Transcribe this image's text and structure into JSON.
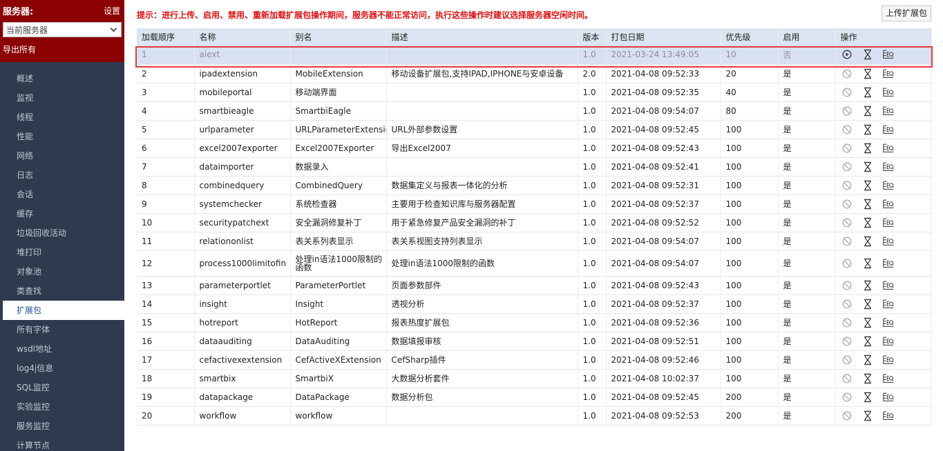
{
  "sidebar": {
    "title": "服务器:",
    "settings": "设置",
    "server_select": "当前服务器",
    "export_all": "导出所有",
    "items": [
      "概述",
      "监视",
      "线程",
      "性能",
      "网络",
      "日志",
      "会话",
      "缓存",
      "垃圾回收活动",
      "堆打印",
      "对象池",
      "类查找",
      "扩展包",
      "所有字体",
      "wsdl地址",
      "log4j信息",
      "SQL监控",
      "实验监控",
      "服务监控",
      "计算节点"
    ],
    "active_index": 12
  },
  "main": {
    "notice": "提示：进行上传、启用、禁用、重新加载扩展包操作期间，服务器不能正常访问，执行这些操作时建议选择服务器空闲时间。",
    "upload_button": "上传扩展包",
    "columns": [
      "加载顺序",
      "名称",
      "别名",
      "描述",
      "版本",
      "打包日期",
      "优先级",
      "启用",
      "操作"
    ],
    "rows": [
      {
        "order": "1",
        "name": "aiext",
        "alias": "",
        "desc": "",
        "version": "1.0",
        "date": "2021-03-24 13:49:05",
        "priority": "10",
        "enabled": "否"
      },
      {
        "order": "2",
        "name": "ipadextension",
        "alias": "MobileExtension",
        "desc": "移动设备扩展包,支持IPAD,IPHONE与安卓设备",
        "version": "2.0",
        "date": "2021-04-08 09:52:33",
        "priority": "20",
        "enabled": "是"
      },
      {
        "order": "3",
        "name": "mobileportal",
        "alias": "移动端界面",
        "desc": "",
        "version": "1.0",
        "date": "2021-04-08 09:52:35",
        "priority": "40",
        "enabled": "是"
      },
      {
        "order": "4",
        "name": "smartbieagle",
        "alias": "SmartbiEagle",
        "desc": "",
        "version": "1.0",
        "date": "2021-04-08 09:54:07",
        "priority": "80",
        "enabled": "是"
      },
      {
        "order": "5",
        "name": "urlparameter",
        "alias": "URLParameterExtension",
        "desc": "URL外部参数设置",
        "version": "1.0",
        "date": "2021-04-08 09:52:45",
        "priority": "100",
        "enabled": "是"
      },
      {
        "order": "6",
        "name": "excel2007exporter",
        "alias": "Excel2007Exporter",
        "desc": "导出Excel2007",
        "version": "1.0",
        "date": "2021-04-08 09:52:43",
        "priority": "100",
        "enabled": "是"
      },
      {
        "order": "7",
        "name": "dataimporter",
        "alias": "数据录入",
        "desc": "",
        "version": "1.0",
        "date": "2021-04-08 09:52:41",
        "priority": "100",
        "enabled": "是"
      },
      {
        "order": "8",
        "name": "combinedquery",
        "alias": "CombinedQuery",
        "desc": "数据集定义与报表一体化的分析",
        "version": "1.0",
        "date": "2021-04-08 09:52:31",
        "priority": "100",
        "enabled": "是"
      },
      {
        "order": "9",
        "name": "systemchecker",
        "alias": "系统检查器",
        "desc": "主要用于检查知识库与服务器配置",
        "version": "1.0",
        "date": "2021-04-08 09:52:37",
        "priority": "100",
        "enabled": "是"
      },
      {
        "order": "10",
        "name": "securitypatchext",
        "alias": "安全漏洞修复补丁",
        "desc": "用于紧急修复产品安全漏洞的补丁",
        "version": "1.0",
        "date": "2021-04-08 09:52:52",
        "priority": "100",
        "enabled": "是"
      },
      {
        "order": "11",
        "name": "relationonlist",
        "alias": "表关系列表显示",
        "desc": "表关系视图支持列表显示",
        "version": "1.0",
        "date": "2021-04-08 09:54:07",
        "priority": "100",
        "enabled": "是"
      },
      {
        "order": "12",
        "name": "process1000limitofin",
        "alias": "处理in语法1000限制的函数",
        "desc": "处理in语法1000限制的函数",
        "version": "1.0",
        "date": "2021-04-08 09:54:07",
        "priority": "100",
        "enabled": "是"
      },
      {
        "order": "13",
        "name": "parameterportlet",
        "alias": "ParameterPortlet",
        "desc": "页面参数部件",
        "version": "1.0",
        "date": "2021-04-08 09:52:43",
        "priority": "100",
        "enabled": "是"
      },
      {
        "order": "14",
        "name": "insight",
        "alias": "Insight",
        "desc": "透视分析",
        "version": "1.0",
        "date": "2021-04-08 09:52:37",
        "priority": "100",
        "enabled": "是"
      },
      {
        "order": "15",
        "name": "hotreport",
        "alias": "HotReport",
        "desc": "报表热度扩展包",
        "version": "1.0",
        "date": "2021-04-08 09:52:36",
        "priority": "100",
        "enabled": "是"
      },
      {
        "order": "16",
        "name": "dataauditing",
        "alias": "DataAuditing",
        "desc": "数据填报审核",
        "version": "1.0",
        "date": "2021-04-08 09:52:51",
        "priority": "100",
        "enabled": "是"
      },
      {
        "order": "17",
        "name": "cefactivexextension",
        "alias": "CefActiveXExtension",
        "desc": "CefSharp插件",
        "version": "1.0",
        "date": "2021-04-08 09:52:46",
        "priority": "100",
        "enabled": "是"
      },
      {
        "order": "18",
        "name": "smartbix",
        "alias": "SmartbiX",
        "desc": "大数据分析套件",
        "version": "1.0",
        "date": "2021-04-08 10:02:37",
        "priority": "100",
        "enabled": "是"
      },
      {
        "order": "19",
        "name": "datapackage",
        "alias": "DataPackage",
        "desc": "数据分析包",
        "version": "1.0",
        "date": "2021-04-08 09:52:45",
        "priority": "200",
        "enabled": "是"
      },
      {
        "order": "20",
        "name": "workflow",
        "alias": "workflow",
        "desc": "",
        "version": "1.0",
        "date": "2021-04-08 09:52:53",
        "priority": "200",
        "enabled": "是"
      }
    ]
  },
  "icons": {
    "enable": "play-circle-icon",
    "disable": "ban-icon",
    "reload": "hourglass-icon",
    "detail": "eq-icon"
  },
  "colors": {
    "sidebar_bg": "#2e3a4d",
    "sidebar_header": "#8b0000",
    "notice": "#e01010",
    "table_header": "#dbe4f0",
    "disabled_row": "#d7e1f1",
    "highlight_border": "#e23b3b"
  }
}
